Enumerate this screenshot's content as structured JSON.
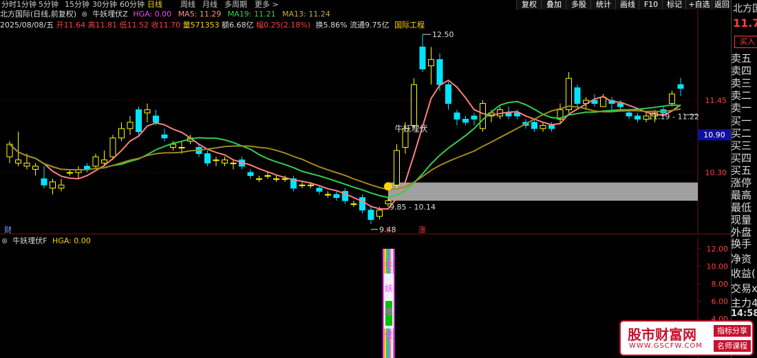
{
  "periods": [
    "分时",
    "1分钟",
    "5分钟",
    "15分钟",
    "30分钟",
    "60分钟",
    "日线",
    "周线",
    "月线",
    "多周期",
    "更多 >"
  ],
  "active_period": "日线",
  "toolbar": [
    "复权",
    "叠加",
    "多股",
    "统计",
    "画线",
    "F10",
    "标记",
    "+自选",
    "返回"
  ],
  "header": {
    "stock": "北方国际(日线,前复权)",
    "indicator_name": "牛妖埋伏Z",
    "hga": "HGA: 0.00",
    "ma5": "MA5: 11.29",
    "ma19": "MA19: 11.21",
    "ma13": "MA13: 11.24"
  },
  "quote": {
    "date": "2025/08/08/五",
    "open": "开11.64",
    "high": "高11.81",
    "low": "低11.52",
    "close": "收11.70",
    "volume": "量571353",
    "amount": "额6.68亿",
    "range": "幅0.25(2.18%)",
    "turnover": "换5.86%",
    "float": "流通9.75亿",
    "sector": "国际工程"
  },
  "price_axis": [
    "11.45",
    "10.30"
  ],
  "current_price_tag": "10.90",
  "annotations": {
    "high_label": "12.50",
    "low_label": "9.48",
    "zone_label": "9.85 - 10.14",
    "right_zone_label": "11.19 - 11.22",
    "signal_text": "牛妖埋伏",
    "marker_cai": "财",
    "marker_s": "S",
    "marker_zhang": "涨"
  },
  "sub_panel": {
    "title": "牛妖埋伏F",
    "hga": "HGA: 0.00",
    "axis": [
      "12.00",
      "10.00",
      "8.00",
      "6.00",
      "4.00"
    ],
    "vertical_chars": [
      "牛",
      "妖",
      "埋",
      "伏"
    ]
  },
  "right_panel": {
    "name": "北方国",
    "price": "11.7",
    "buy_button": "买入",
    "items": [
      "卖五",
      "卖四",
      "卖三",
      "卖二",
      "卖一",
      "买一",
      "买二",
      "买三",
      "买四",
      "买五",
      "涨停",
      "最高",
      "最低",
      "现量",
      "外盘"
    ],
    "items2": [
      "换手",
      "净资",
      "收益(",
      "交易x",
      "主力4"
    ],
    "time": "14:58"
  },
  "watermark": {
    "title": "股市财富网",
    "url": "WWW.GSCFW.COM",
    "tag1": "指标分享",
    "tag2": "名师课程"
  },
  "colors": {
    "up": "#ffff00",
    "down": "#00e5ff",
    "ma5": "#ff8080",
    "ma13": "#30d050",
    "ma19": "#a08a20",
    "zone": "#a0a0a0"
  },
  "chart_data": {
    "type": "candlestick",
    "price_ticks": [
      11.45,
      10.3
    ],
    "ohlc": [
      [
        10.55,
        10.8,
        10.45,
        10.75
      ],
      [
        10.45,
        10.95,
        10.4,
        10.5
      ],
      [
        10.4,
        10.6,
        10.35,
        10.45
      ],
      [
        10.35,
        10.45,
        10.25,
        10.4
      ],
      [
        10.2,
        10.4,
        10.05,
        10.1
      ],
      [
        10.05,
        10.2,
        9.95,
        10.15
      ],
      [
        10.05,
        10.2,
        10.0,
        10.1
      ],
      [
        10.3,
        10.35,
        10.25,
        10.3
      ],
      [
        10.3,
        10.4,
        10.2,
        10.35
      ],
      [
        10.4,
        10.45,
        10.3,
        10.35
      ],
      [
        10.4,
        10.6,
        10.35,
        10.55
      ],
      [
        10.45,
        10.65,
        10.4,
        10.5
      ],
      [
        10.55,
        10.9,
        10.5,
        10.85
      ],
      [
        10.85,
        11.1,
        10.8,
        11.0
      ],
      [
        11.0,
        11.2,
        10.9,
        11.1
      ],
      [
        11.3,
        11.35,
        10.9,
        10.95
      ],
      [
        11.25,
        11.4,
        11.1,
        11.3
      ],
      [
        11.2,
        11.3,
        11.05,
        11.1
      ],
      [
        10.9,
        11.0,
        10.8,
        10.85
      ],
      [
        10.7,
        10.8,
        10.65,
        10.75
      ],
      [
        10.7,
        10.8,
        10.6,
        10.7
      ],
      [
        10.8,
        10.9,
        10.75,
        10.85
      ],
      [
        10.7,
        10.75,
        10.55,
        10.6
      ],
      [
        10.6,
        10.65,
        10.4,
        10.45
      ],
      [
        10.5,
        10.55,
        10.4,
        10.5
      ],
      [
        10.45,
        10.55,
        10.4,
        10.5
      ],
      [
        10.45,
        10.5,
        10.35,
        10.45
      ],
      [
        10.5,
        10.55,
        10.35,
        10.4
      ],
      [
        10.3,
        10.35,
        10.2,
        10.25
      ],
      [
        10.2,
        10.25,
        10.15,
        10.2
      ],
      [
        10.25,
        10.3,
        10.2,
        10.25
      ],
      [
        10.2,
        10.25,
        10.15,
        10.2
      ],
      [
        10.2,
        10.25,
        10.15,
        10.2
      ],
      [
        10.2,
        10.25,
        10.0,
        10.05
      ],
      [
        10.1,
        10.15,
        10.05,
        10.1
      ],
      [
        10.1,
        10.15,
        10.05,
        10.1
      ],
      [
        10.05,
        10.1,
        9.95,
        10.0
      ],
      [
        9.95,
        10.0,
        9.9,
        9.95
      ],
      [
        9.95,
        10.0,
        9.85,
        9.9
      ],
      [
        10.0,
        10.05,
        9.8,
        9.85
      ],
      [
        9.8,
        9.85,
        9.75,
        9.8
      ],
      [
        9.9,
        9.95,
        9.65,
        9.7
      ],
      [
        9.7,
        9.75,
        9.48,
        9.55
      ],
      [
        9.6,
        9.75,
        9.55,
        9.7
      ],
      [
        9.8,
        9.9,
        9.75,
        9.85
      ],
      [
        10.1,
        10.75,
        10.05,
        10.65
      ],
      [
        10.7,
        11.1,
        10.6,
        11.0
      ],
      [
        11.05,
        11.8,
        11.0,
        11.7
      ],
      [
        12.3,
        12.5,
        11.9,
        11.95
      ],
      [
        12.0,
        12.3,
        11.7,
        12.1
      ],
      [
        12.1,
        12.2,
        11.6,
        11.7
      ],
      [
        11.7,
        11.75,
        11.3,
        11.4
      ],
      [
        11.25,
        11.3,
        11.05,
        11.15
      ],
      [
        11.15,
        11.2,
        11.05,
        11.1
      ],
      [
        11.2,
        11.25,
        11.05,
        11.15
      ],
      [
        11.0,
        11.45,
        10.95,
        11.4
      ],
      [
        11.2,
        11.3,
        11.1,
        11.25
      ],
      [
        11.2,
        11.35,
        11.15,
        11.3
      ],
      [
        11.25,
        11.35,
        11.15,
        11.2
      ],
      [
        11.25,
        11.3,
        11.15,
        11.2
      ],
      [
        11.1,
        11.15,
        11.0,
        11.05
      ],
      [
        11.1,
        11.15,
        10.95,
        11.0
      ],
      [
        11.0,
        11.1,
        10.95,
        11.05
      ],
      [
        11.05,
        11.1,
        10.95,
        11.0
      ],
      [
        11.15,
        11.4,
        11.1,
        11.3
      ],
      [
        11.3,
        11.9,
        11.25,
        11.8
      ],
      [
        11.65,
        11.7,
        11.35,
        11.4
      ],
      [
        11.4,
        11.5,
        11.3,
        11.45
      ],
      [
        11.45,
        11.55,
        11.35,
        11.4
      ],
      [
        11.35,
        11.55,
        11.35,
        11.5
      ],
      [
        11.45,
        11.5,
        11.3,
        11.4
      ],
      [
        11.4,
        11.45,
        11.3,
        11.35
      ],
      [
        11.25,
        11.3,
        11.15,
        11.2
      ],
      [
        11.2,
        11.25,
        11.1,
        11.15
      ],
      [
        11.15,
        11.25,
        11.1,
        11.2
      ],
      [
        11.2,
        11.3,
        11.1,
        11.25
      ],
      [
        11.3,
        11.35,
        11.2,
        11.25
      ],
      [
        11.4,
        11.6,
        11.35,
        11.55
      ],
      [
        11.7,
        11.81,
        11.52,
        11.64
      ]
    ]
  }
}
